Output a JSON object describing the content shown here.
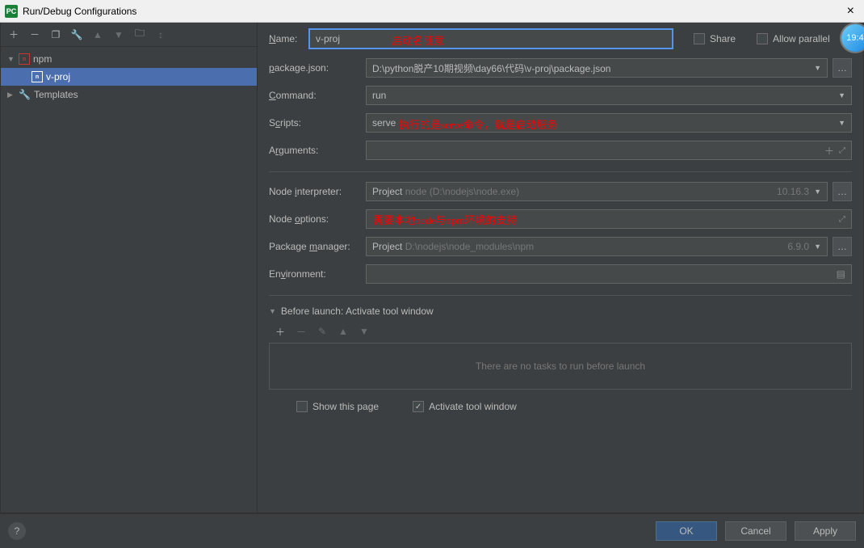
{
  "window": {
    "title": "Run/Debug Configurations",
    "icon_text": "PC"
  },
  "tree": {
    "npm_label": "npm",
    "vproj_label": "v-proj",
    "templates_label": "Templates"
  },
  "form": {
    "name_label": "Name:",
    "name_value": "v-proj",
    "share_label": "Share",
    "parallel_label": "Allow parallel",
    "package_json_label": "package.json:",
    "package_json_value": "D:\\python脱产10期视频\\day66\\代码\\v-proj\\package.json",
    "command_label": "Command:",
    "command_value": "run",
    "scripts_label": "Scripts:",
    "scripts_value": "serve",
    "arguments_label": "Arguments:",
    "arguments_value": "",
    "node_interpreter_label": "Node interpreter:",
    "node_interpreter_prefix": "Project",
    "node_interpreter_path": "  node (D:\\nodejs\\node.exe)",
    "node_interpreter_version": "10.16.3",
    "node_options_label": "Node options:",
    "node_options_value": "",
    "package_manager_label": "Package manager:",
    "package_manager_prefix": "Project",
    "package_manager_path": "  D:\\nodejs\\node_modules\\npm",
    "package_manager_version": "6.9.0",
    "environment_label": "Environment:",
    "environment_value": "",
    "before_launch_label": "Before launch: Activate tool window",
    "tasks_empty": "There are no tasks to run before launch",
    "show_page_label": "Show this page",
    "activate_tw_label": "Activate tool window"
  },
  "buttons": {
    "ok": "OK",
    "cancel": "Cancel",
    "apply": "Apply"
  },
  "annotations": {
    "name_note": "启动名随意",
    "scripts_note": "执行的是serve命令，就是启动服务",
    "node_note": "需要本地node与npm环境的支持"
  },
  "clock": "19:4"
}
